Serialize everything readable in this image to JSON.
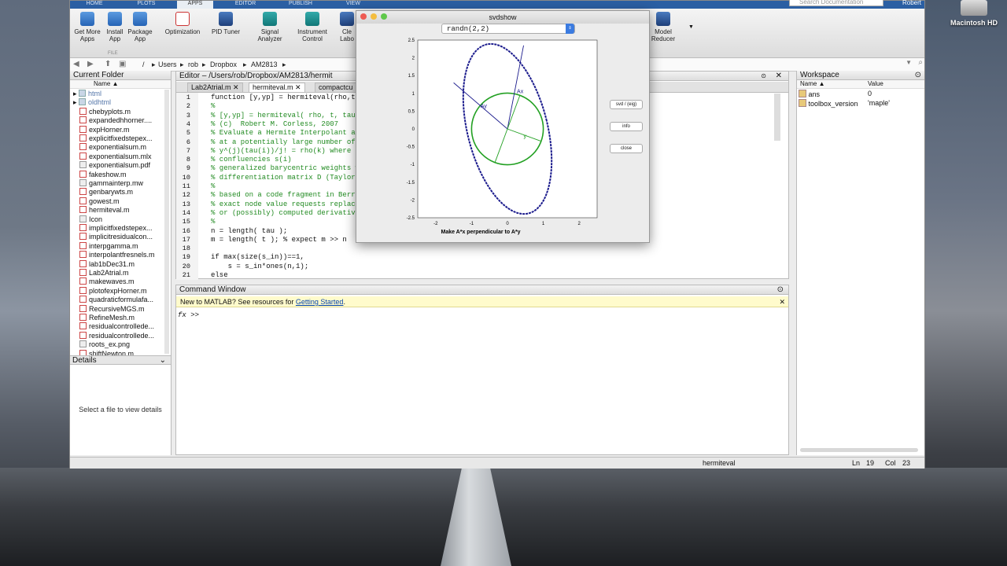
{
  "desktop": {
    "drive_label": "Macintosh HD"
  },
  "ribbon": {
    "tabs": [
      "HOME",
      "PLOTS",
      "APPS",
      "EDITOR",
      "PUBLISH",
      "VIEW"
    ],
    "buttons": [
      {
        "label1": "Get More",
        "label2": "Apps"
      },
      {
        "label1": "Install",
        "label2": "App"
      },
      {
        "label1": "Package",
        "label2": "App"
      },
      {
        "label1": "Optimization",
        "label2": ""
      },
      {
        "label1": "PID Tuner",
        "label2": ""
      },
      {
        "label1": "Signal",
        "label2": "Analyzer"
      },
      {
        "label1": "Instrument",
        "label2": "Control"
      },
      {
        "label1": "Cle",
        "label2": "Labo"
      },
      {
        "label1": "Model",
        "label2": "Reducer"
      }
    ],
    "file_group": "FILE",
    "search_placeholder": "Search Documentation",
    "user": "Robert"
  },
  "address": {
    "crumbs": [
      "/",
      "Users",
      "rob",
      "Dropbox",
      "AM2813"
    ]
  },
  "current_folder": {
    "title": "Current Folder",
    "col_name": "Name ▲",
    "files": [
      {
        "name": "html",
        "kind": "folder"
      },
      {
        "name": "oldhtml",
        "kind": "folder"
      },
      {
        "name": "chebyplots.m",
        "kind": "m"
      },
      {
        "name": "expandedhhorner....",
        "kind": "m"
      },
      {
        "name": "expHorner.m",
        "kind": "m"
      },
      {
        "name": "explicitfixedstepex...",
        "kind": "m"
      },
      {
        "name": "exponentialsum.m",
        "kind": "m"
      },
      {
        "name": "exponentialsum.mlx",
        "kind": "m"
      },
      {
        "name": "exponentialsum.pdf",
        "kind": "doc"
      },
      {
        "name": "fakeshow.m",
        "kind": "m"
      },
      {
        "name": "gammainterp.mw",
        "kind": "doc"
      },
      {
        "name": "genbarywts.m",
        "kind": "m"
      },
      {
        "name": "gowest.m",
        "kind": "m"
      },
      {
        "name": "hermiteval.m",
        "kind": "m"
      },
      {
        "name": "Icon",
        "kind": "doc"
      },
      {
        "name": "implicitfixedstepex...",
        "kind": "m"
      },
      {
        "name": "implicitresidualcon...",
        "kind": "m"
      },
      {
        "name": "interpgamma.m",
        "kind": "m"
      },
      {
        "name": "interpolantfresnels.m",
        "kind": "m"
      },
      {
        "name": "lab1bDec31.m",
        "kind": "m"
      },
      {
        "name": "Lab2Atrial.m",
        "kind": "m"
      },
      {
        "name": "makewaves.m",
        "kind": "m"
      },
      {
        "name": "plotofexpHorner.m",
        "kind": "m"
      },
      {
        "name": "quadraticformulafa...",
        "kind": "m"
      },
      {
        "name": "RecursiveMGS.m",
        "kind": "m"
      },
      {
        "name": "RefineMesh.m",
        "kind": "m"
      },
      {
        "name": "residualcontrollede...",
        "kind": "m"
      },
      {
        "name": "residualcontrollede...",
        "kind": "m"
      },
      {
        "name": "roots_ex.png",
        "kind": "doc"
      },
      {
        "name": "shiftNewton.m",
        "kind": "m"
      }
    ],
    "details_title": "Details",
    "details_text": "Select a file to view details"
  },
  "editor": {
    "title": "Editor – /Users/rob/Dropbox/AM2813/hermit",
    "tabs": [
      "Lab2Atrial.m",
      "hermiteval.m",
      "compactcu"
    ],
    "lines": [
      {
        "n": "1",
        "t": "function [y,yp] = hermiteval(rho,t,",
        "c": false
      },
      {
        "n": "2",
        "t": "%",
        "c": true
      },
      {
        "n": "3",
        "t": "% [y,yp] = hermiteval( rho, t, tau,",
        "c": true
      },
      {
        "n": "4",
        "t": "% (c)  Robert M. Corless, 2007",
        "c": true
      },
      {
        "n": "5",
        "t": "% Evaluate a Hermite Interpolant an",
        "c": true
      },
      {
        "n": "6",
        "t": "% at a potentially large number of",
        "c": true
      },
      {
        "n": "7",
        "t": "% y^(j)(tau(i))/j! = rho(k) where k",
        "c": true
      },
      {
        "n": "8",
        "t": "% confluencies s(i)",
        "c": true
      },
      {
        "n": "9",
        "t": "% generalized barycentric weights w",
        "c": true
      },
      {
        "n": "10",
        "t": "% differentiation matrix D (Taylor",
        "c": true
      },
      {
        "n": "11",
        "t": "%",
        "c": true
      },
      {
        "n": "12",
        "t": "% based on a code fragment in Berru",
        "c": true
      },
      {
        "n": "13",
        "t": "% exact node value requests replace",
        "c": true
      },
      {
        "n": "14",
        "t": "% or (possibly) computed derivative",
        "c": true
      },
      {
        "n": "15",
        "t": "%",
        "c": true
      },
      {
        "n": "16",
        "t": "n = length( tau );",
        "c": false
      },
      {
        "n": "17",
        "t": "m = length( t ); % expect m >> n",
        "c": false
      },
      {
        "n": "18",
        "t": "",
        "c": false
      },
      {
        "n": "19",
        "t": "if max(size(s_in))==1,",
        "c": false
      },
      {
        "n": "20",
        "t": "    s = s_in*ones(n,1);",
        "c": false
      },
      {
        "n": "21",
        "t": "else",
        "c": false
      }
    ]
  },
  "command_window": {
    "title": "Command Window",
    "banner_text": "New to MATLAB? See resources for ",
    "banner_link": "Getting Started",
    "banner_tail": ".",
    "prompt": ">>"
  },
  "workspace": {
    "title": "Workspace",
    "col_name": "Name ▲",
    "col_value": "Value",
    "vars": [
      {
        "name": "ans",
        "value": "0"
      },
      {
        "name": "toolbox_version",
        "value": "'maple'"
      }
    ]
  },
  "status": {
    "function": "hermiteval",
    "ln_label": "Ln",
    "ln": "19",
    "col_label": "Col",
    "col": "23"
  },
  "figure": {
    "title": "svdshow",
    "dropdown_value": "randn(2,2)",
    "buttons": [
      "svd / (eig)",
      "info",
      "close"
    ],
    "xlabel": "Make A*x perpendicular to A*y",
    "labels": {
      "ax": "Ax",
      "ay": "Ay",
      "x": "x",
      "y": "y"
    },
    "ellipse_color": "#1a1a8c",
    "circle_color": "#22a022"
  },
  "chart_data": {
    "type": "scatter",
    "title": "",
    "xlabel": "Make A*x perpendicular to A*y",
    "ylabel": "",
    "xlim": [
      -2.5,
      2.5
    ],
    "ylim": [
      -2.5,
      2.5
    ],
    "xticks": [
      -2,
      -1,
      0,
      1,
      2
    ],
    "yticks": [
      2.5,
      2,
      1.5,
      1,
      0.5,
      0,
      -0.5,
      -1,
      -1.5,
      -2,
      -2.5
    ],
    "series": [
      {
        "shape": "ellipse",
        "center": [
          0,
          0
        ],
        "extent_x": [
          -1.55,
          1.55
        ],
        "extent_y": [
          -2.5,
          2.5
        ]
      },
      {
        "shape": "unit-circle",
        "center": [
          0,
          0
        ],
        "radius": 1
      },
      {
        "shape": "vector",
        "label": "Ax",
        "to": [
          0.45,
          2.35
        ]
      },
      {
        "shape": "vector",
        "label": "Ay",
        "to": [
          -1.5,
          1.3
        ]
      },
      {
        "shape": "vector",
        "label": "x",
        "to": [
          0.35,
          0.95
        ]
      },
      {
        "shape": "vector",
        "label": "y",
        "to": [
          0.95,
          -0.35
        ]
      }
    ]
  }
}
